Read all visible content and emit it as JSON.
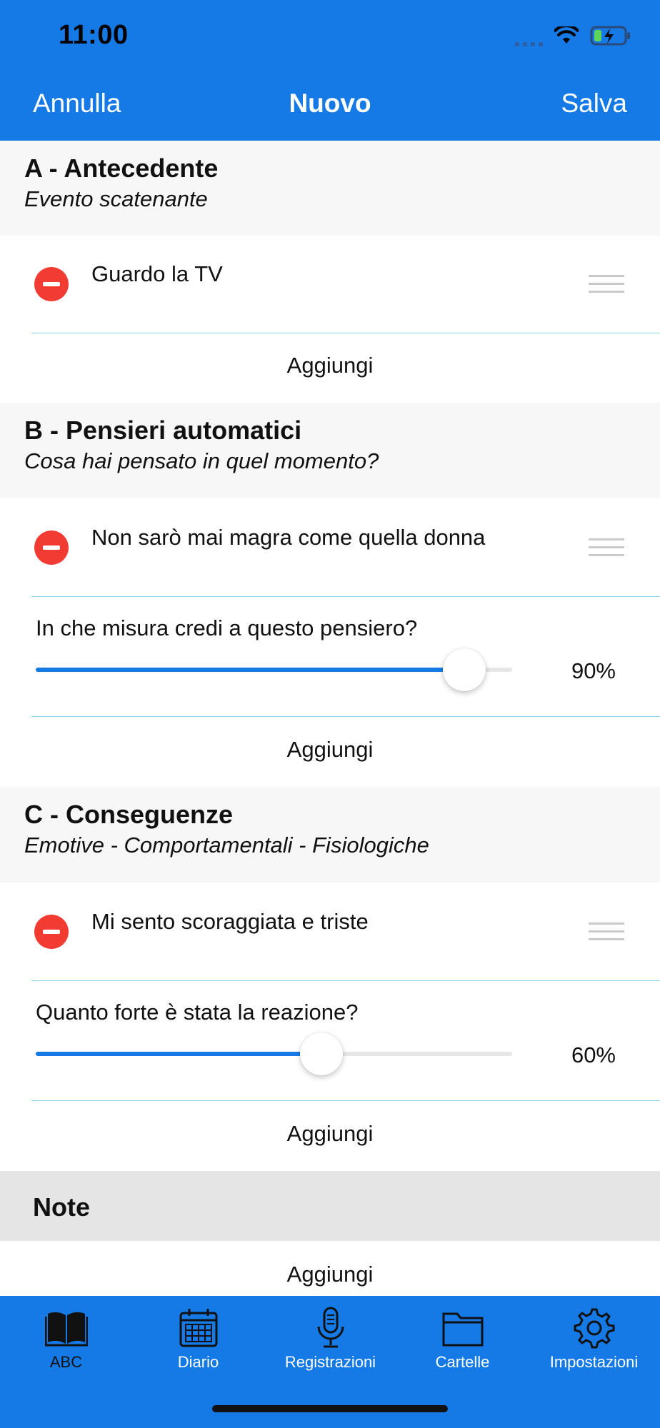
{
  "status_bar": {
    "time": "11:00"
  },
  "nav": {
    "cancel": "Annulla",
    "title": "Nuovo",
    "save": "Salva"
  },
  "sections": [
    {
      "title": "A - Antecedente",
      "subtitle": "Evento scatenante",
      "item": "Guardo la TV",
      "add": "Aggiungi"
    },
    {
      "title": "B - Pensieri automatici",
      "subtitle": "Cosa hai pensato in quel momento?",
      "item": "Non sarò mai magra come quella donna",
      "question": "In che misura credi a questo pensiero?",
      "slider_value": 0.9,
      "slider_label": "90%",
      "add": "Aggiungi"
    },
    {
      "title": "C - Conseguenze",
      "subtitle": "Emotive - Comportamentali - Fisiologiche",
      "item": "Mi sento scoraggiata e triste",
      "question": "Quanto forte è stata la reazione?",
      "slider_value": 0.6,
      "slider_label": "60%",
      "add": "Aggiungi"
    }
  ],
  "notes": {
    "title": "Note",
    "add": "Aggiungi"
  },
  "tabbar": {
    "items": [
      {
        "label": "ABC",
        "icon": "book-icon",
        "active": true
      },
      {
        "label": "Diario",
        "icon": "calendar-icon"
      },
      {
        "label": "Registrazioni",
        "icon": "microphone-icon"
      },
      {
        "label": "Cartelle",
        "icon": "folder-icon"
      },
      {
        "label": "Impostazioni",
        "icon": "gear-icon"
      }
    ]
  },
  "colors": {
    "accent": "#157ae6",
    "delete": "#f23b32",
    "separator": "#8fd3ea"
  }
}
